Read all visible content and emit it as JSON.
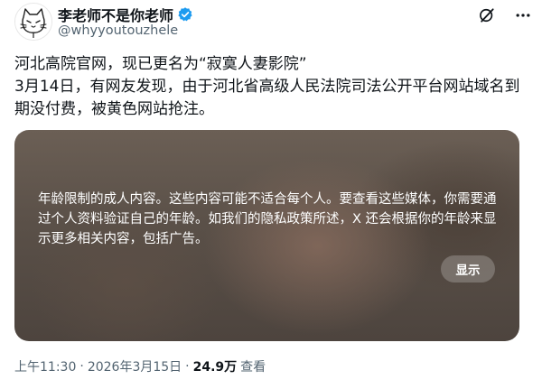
{
  "author": {
    "display_name": "李老师不是你老师",
    "handle": "@whyyoutouzhele",
    "verified": true
  },
  "tweet": {
    "text": "河北高院官网，现已更名为“寂寞人妻影院”\n3月14日，有网友发现，由于河北省高级人民法院司法公开平台网站域名到期没付费，被黄色网站抢注。"
  },
  "media": {
    "warning_text": "年龄限制的成人内容。这些内容可能不适合每个人。要查看这些媒体，你需要通过个人资料验证自己的年龄。如我们的隐私政策所述，X 还会根据你的年龄来显示更多相关内容，包括广告。",
    "show_button_label": "显示"
  },
  "meta": {
    "time": "上午11:30",
    "separator": "·",
    "date": "2026年3月15日",
    "views_count": "24.9万",
    "views_label": "查看"
  },
  "icons": {
    "grok": "grok-icon",
    "more": "more-icon",
    "verified": "verified-badge-icon",
    "avatar": "cat-avatar"
  },
  "colors": {
    "verified_blue": "#1d9bf0",
    "text_primary": "#0f1419",
    "text_secondary": "#536471"
  }
}
